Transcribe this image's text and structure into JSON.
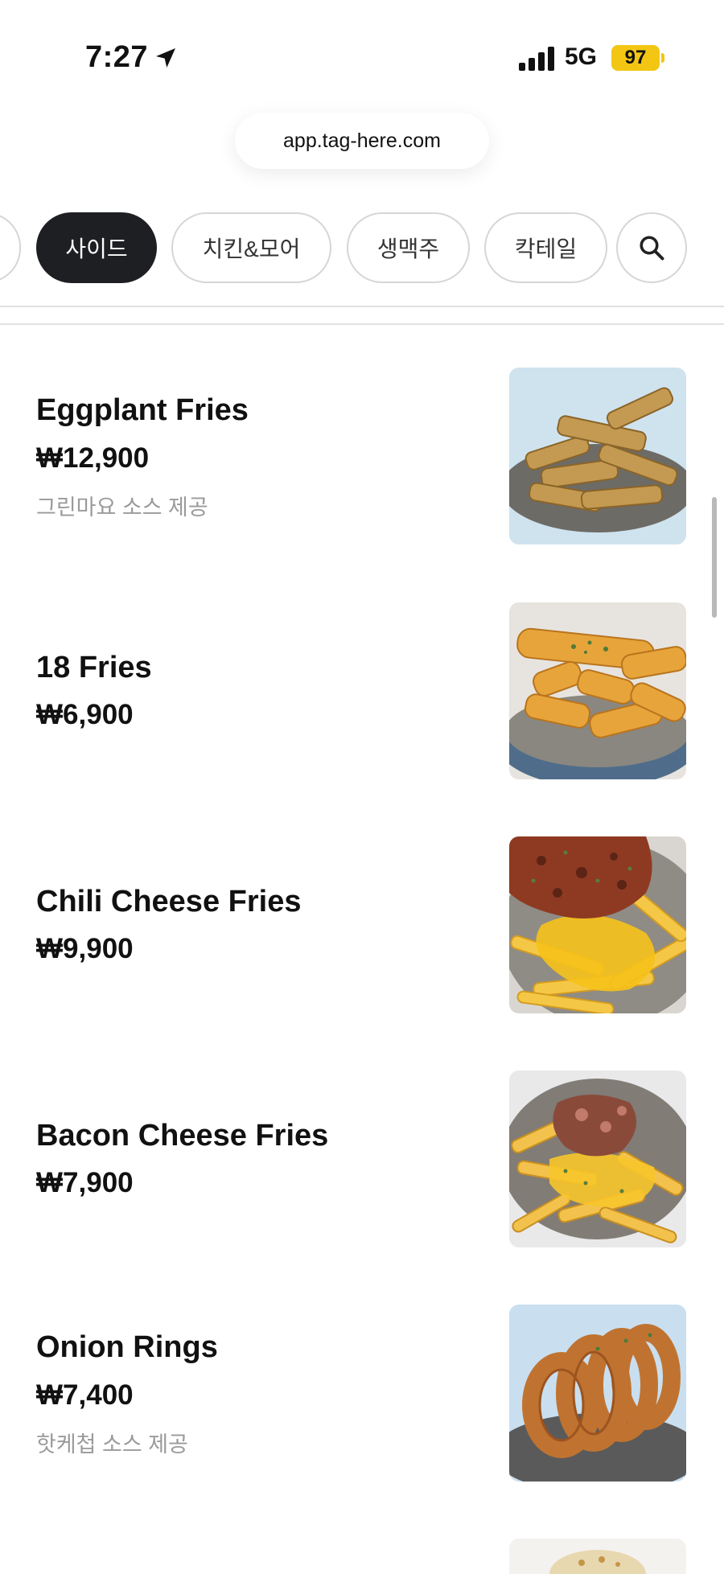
{
  "status_bar": {
    "time": "7:27",
    "location_icon": "location-arrow-icon",
    "signal_icon": "signal-bars-icon",
    "network": "5G",
    "battery": "97",
    "battery_color": "#f3c613"
  },
  "browser": {
    "url": "app.tag-here.com"
  },
  "categories": {
    "tabs": [
      {
        "label": "사이드",
        "active": true
      },
      {
        "label": "치킨&모어",
        "active": false
      },
      {
        "label": "생맥주",
        "active": false
      },
      {
        "label": "칵테일",
        "active": false
      }
    ],
    "search_icon": "search-icon"
  },
  "menu": {
    "items": [
      {
        "name": "Eggplant Fries",
        "price": "₩12,900",
        "description": "그린마요 소스 제공"
      },
      {
        "name": "18 Fries",
        "price": "₩6,900",
        "description": ""
      },
      {
        "name": "Chili Cheese Fries",
        "price": "₩9,900",
        "description": ""
      },
      {
        "name": "Bacon Cheese Fries",
        "price": "₩7,900",
        "description": ""
      },
      {
        "name": "Onion Rings",
        "price": "₩7,400",
        "description": "핫케첩 소스 제공"
      }
    ]
  },
  "colors": {
    "active_tab_bg": "#1e1f22",
    "text_primary": "#111111",
    "text_secondary": "#9a9a9a",
    "border": "#d6d6d6"
  }
}
